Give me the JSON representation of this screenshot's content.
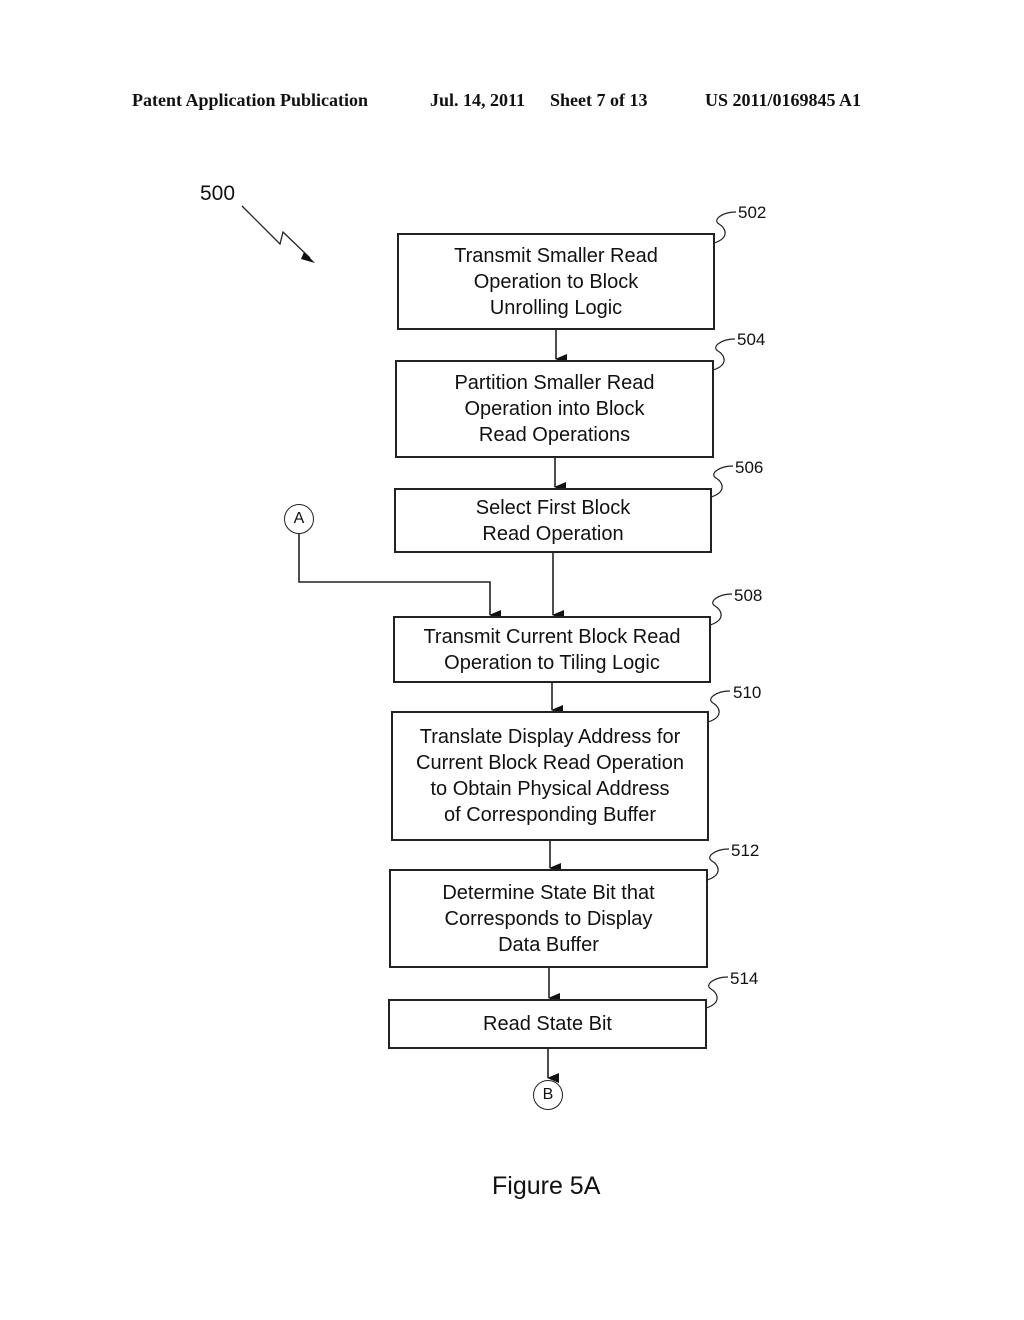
{
  "header": {
    "publication": "Patent Application Publication",
    "date": "Jul. 14, 2011",
    "sheet": "Sheet 7 of 13",
    "number": "US 2011/0169845 A1"
  },
  "diagram": {
    "figure_number": "500",
    "caption": "Figure 5A",
    "steps": [
      {
        "id": "502",
        "text": "Transmit Smaller Read\nOperation to Block\nUnrolling Logic"
      },
      {
        "id": "504",
        "text": "Partition Smaller Read\nOperation into Block\nRead Operations"
      },
      {
        "id": "506",
        "text": "Select First Block\nRead Operation"
      },
      {
        "id": "508",
        "text": "Transmit Current Block Read\nOperation to Tiling Logic"
      },
      {
        "id": "510",
        "text": "Translate Display Address for\nCurrent Block Read Operation\nto Obtain Physical Address\nof Corresponding Buffer"
      },
      {
        "id": "512",
        "text": "Determine State Bit that\nCorresponds to Display\nData Buffer"
      },
      {
        "id": "514",
        "text": "Read State Bit"
      }
    ],
    "connectors": {
      "in": "A",
      "out": "B"
    }
  }
}
